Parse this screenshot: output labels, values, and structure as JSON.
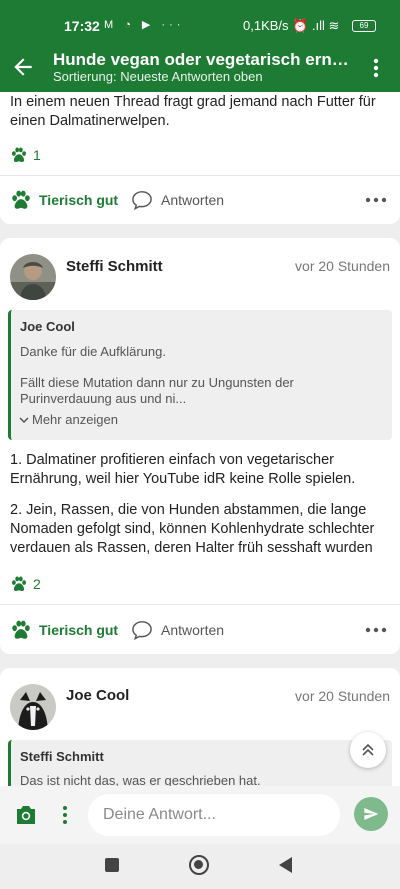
{
  "status_bar": {
    "time": "17:32",
    "icons": "M ◔ ▶ ···",
    "network": "0,1KB/s ⏰ .ıll ≋",
    "battery": "69"
  },
  "header": {
    "title": "Hunde vegan oder vegetarisch ernähre...",
    "subtitle": "Sortierung: Neueste Antworten oben"
  },
  "posts": [
    {
      "text_lines": [
        "In einem neuen Thread fragt grad jemand nach Futter für",
        "einen Dalmatinerwelpen."
      ],
      "likes": "1",
      "like_label": "Tierisch gut",
      "reply_label": "Antworten"
    },
    {
      "author": "Steffi Schmitt",
      "time": "vor 20 Stunden",
      "quote": {
        "author": "Joe Cool",
        "line1": "Danke für die Aufklärung.",
        "line2": "Fällt diese Mutation dann nur zu Ungunsten der",
        "line3": "Purinverdauung aus und ni...",
        "more": "Mehr anzeigen"
      },
      "para1_lines": [
        "1. Dalmatiner profitieren einfach von vegetarischer",
        "Ernährung, weil hier YouTube idR keine Rolle spielen."
      ],
      "para2_lines": [
        "2. Jein, Rassen, die von Hunden abstammen, die lange",
        "Nomaden gefolgt sind, können Kohlenhydrate schlechter",
        "verdauen als Rassen, deren Halter früh sesshaft wurden"
      ],
      "likes": "2",
      "like_label": "Tierisch gut",
      "reply_label": "Antworten"
    },
    {
      "author": "Joe Cool",
      "time": "vor 20 Stunden",
      "quote": {
        "author": "Steffi Schmitt",
        "line1": "Das ist nicht das, was er geschrieben hat."
      }
    }
  ],
  "composer": {
    "placeholder": "Deine Antwort..."
  },
  "colors": {
    "brand": "#1e7b34",
    "send_disabled": "#7fba8c"
  }
}
